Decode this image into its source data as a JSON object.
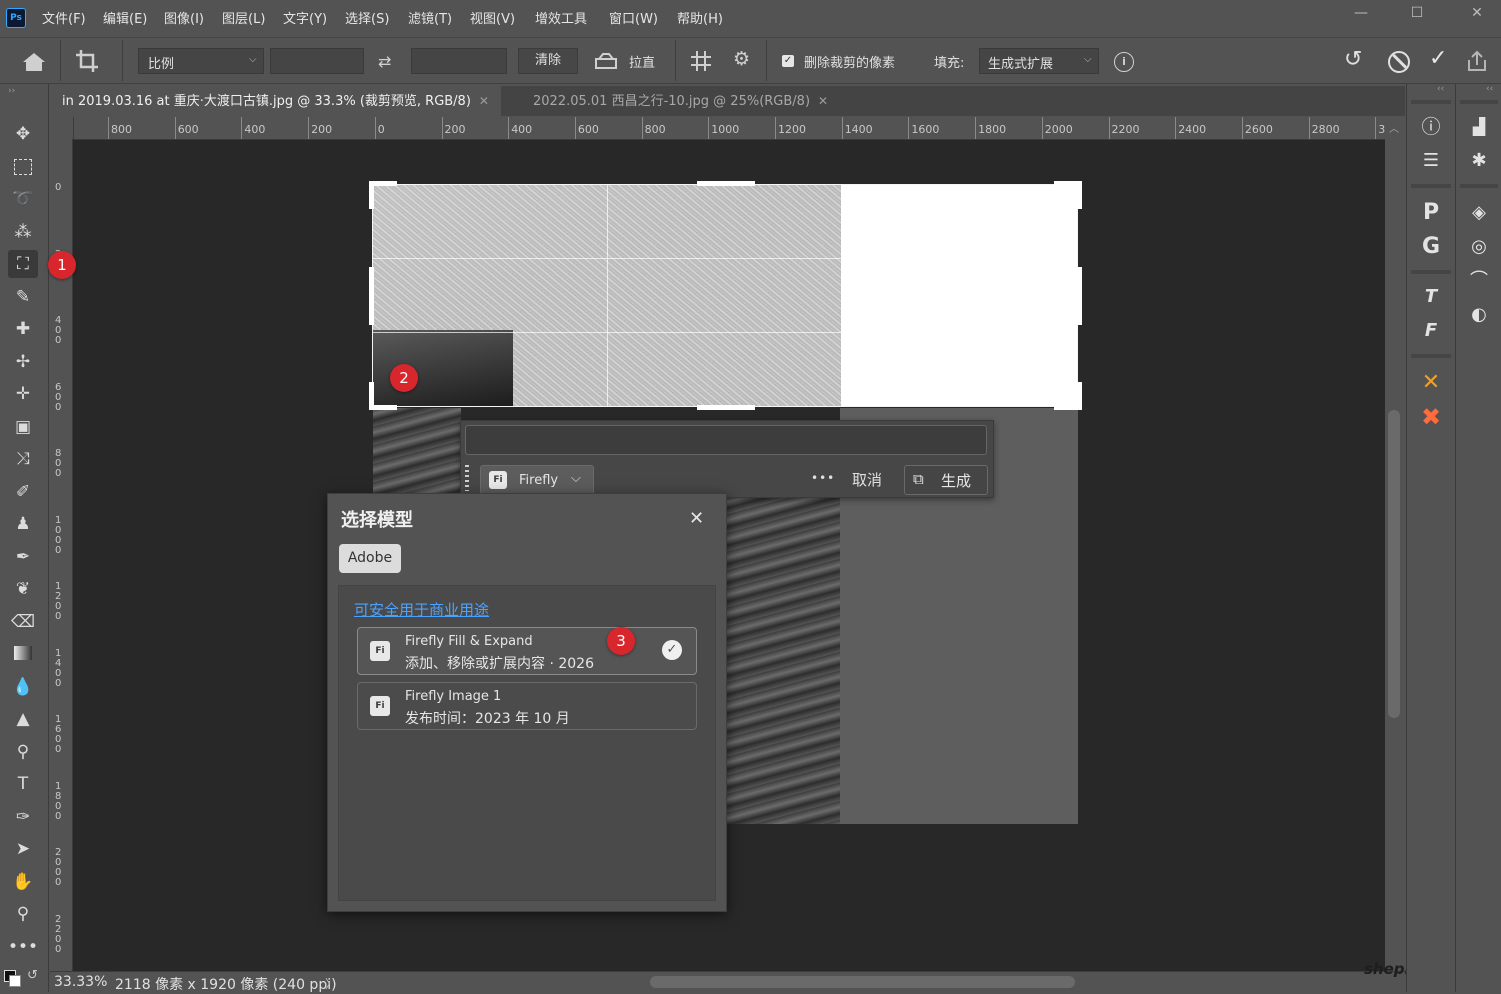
{
  "app": {
    "logo": "Ps"
  },
  "menu": [
    "文件(F)",
    "编辑(E)",
    "图像(I)",
    "图层(L)",
    "文字(Y)",
    "选择(S)",
    "滤镜(T)",
    "视图(V)",
    "增效工具",
    "窗口(W)",
    "帮助(H)"
  ],
  "window_controls": {
    "minimize": "—",
    "maximize": "☐",
    "close": "✕"
  },
  "options": {
    "ratio_label": "比例",
    "clear_label": "清除",
    "straighten_label": "拉直",
    "delete_cropped_label": "删除裁剪的像素",
    "delete_cropped_checked": true,
    "fill_label": "填充:",
    "fill_value": "生成式扩展"
  },
  "tabs": [
    {
      "label": "in 2019.03.16 at 重庆·大渡口古镇.jpg @ 33.3% (裁剪预览, RGB/8)",
      "active": true
    },
    {
      "label": "2022.05.01 西昌之行-10.jpg @ 25%(RGB/8)",
      "active": false
    }
  ],
  "ruler_h": [
    "800",
    "600",
    "400",
    "200",
    "0",
    "200",
    "400",
    "600",
    "800",
    "1000",
    "1200",
    "1400",
    "1600",
    "1800",
    "2000",
    "2200",
    "2400",
    "2600",
    "2800",
    "3"
  ],
  "ruler_v": [
    "0",
    "2",
    "4\n0\n0",
    "6\n0\n0",
    "8\n0\n0",
    "1\n0\n0\n0",
    "1\n2\n0\n0",
    "1\n4\n0\n0",
    "1\n6\n0\n0",
    "1\n8\n0\n0",
    "2\n0\n0\n0",
    "2\n2\n0\n0"
  ],
  "prompt": {
    "input_value": "",
    "model_button": "Firefly",
    "more": "•••",
    "cancel": "取消",
    "generate": "生成"
  },
  "modal": {
    "title": "选择模型",
    "provider_tab": "Adobe",
    "section_link": "可安全用于商业用途",
    "models": [
      {
        "name": "Firefly Fill & Expand",
        "desc": "添加、移除或扩展内容 · 2026",
        "selected": true
      },
      {
        "name": "Firefly Image 1",
        "desc": "发布时间：2023 年 10 月",
        "selected": false
      }
    ]
  },
  "badges": [
    "1",
    "2",
    "3"
  ],
  "status": {
    "zoom": "33.33%",
    "dimensions": "2118 像素 x 1920 像素 (240 ppi)",
    "arrow": "〉"
  },
  "watermark": "shephe.com",
  "icons": {
    "tools": [
      "move-icon",
      "marquee-icon",
      "lasso-icon",
      "magic-wand-icon",
      "crop-icon",
      "eyedropper-icon",
      "spot-healing-icon",
      "healing-icon",
      "patch-icon",
      "content-aware-icon",
      "shuffle-icon",
      "brush-icon",
      "stamp-icon",
      "history-brush-icon",
      "eraser-icon",
      "gradient-icon",
      "blur-icon",
      "sharpen-icon",
      "dodge-icon",
      "type-icon",
      "pen-icon",
      "path-select-icon",
      "hand-icon",
      "zoom-icon",
      "more-icon"
    ]
  }
}
